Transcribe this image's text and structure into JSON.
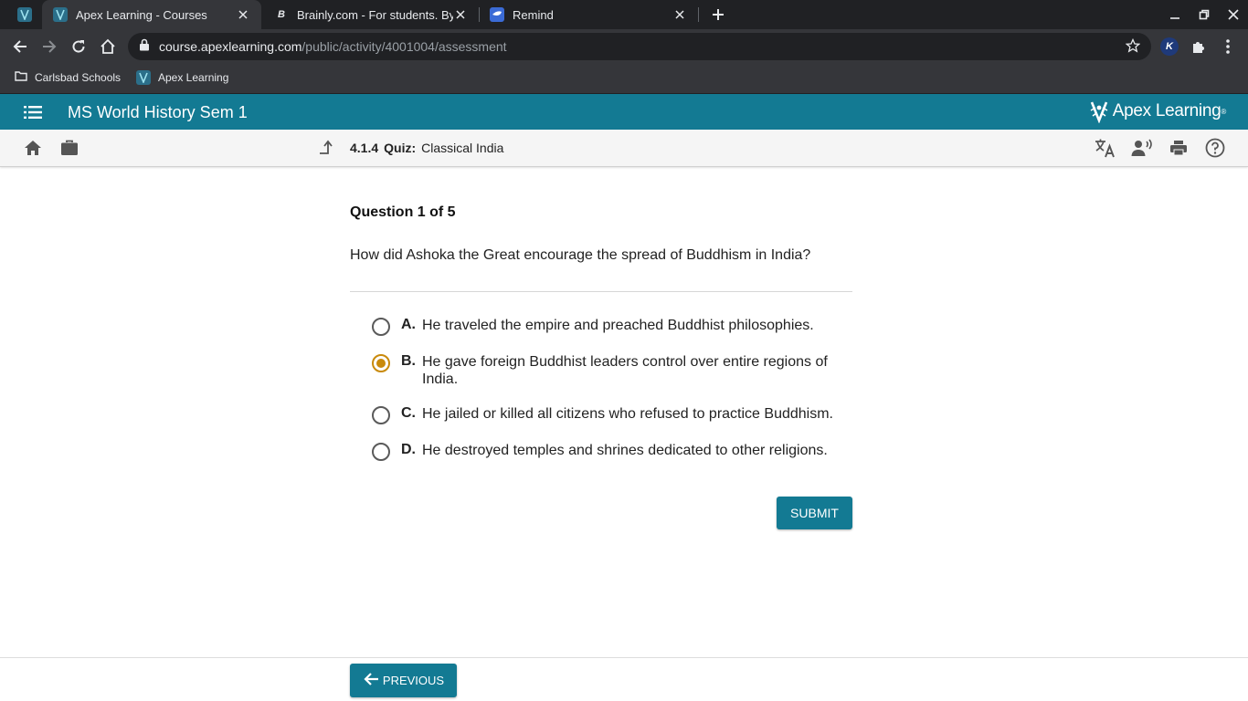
{
  "browser": {
    "tabs": [
      {
        "title": "Apex Learning - Courses",
        "active": true
      },
      {
        "title": "Brainly.com - For students. By students.",
        "active": false
      },
      {
        "title": "Remind",
        "active": false
      }
    ],
    "url_domain": "course.apexlearning.com",
    "url_path": "/public/activity/4001004/assessment",
    "profile_initial": "K",
    "bookmarks": [
      "Carlsbad Schools",
      "Apex Learning"
    ]
  },
  "header": {
    "course_title": "MS World History Sem 1",
    "logo_text": "Apex Learning",
    "logo_mark": "®"
  },
  "breadcrumb": {
    "number": "4.1.4",
    "type": "Quiz:",
    "title": "Classical India"
  },
  "quiz": {
    "counter": "Question 1 of 5",
    "question": "How did Ashoka the Great encourage the spread of Buddhism in India?",
    "choices": [
      {
        "letter": "A.",
        "text": "He traveled the empire and preached Buddhist philosophies.",
        "selected": false
      },
      {
        "letter": "B.",
        "text": "He gave foreign Buddhist leaders control over entire regions of India.",
        "selected": true
      },
      {
        "letter": "C.",
        "text": "He jailed or killed all citizens who refused to practice Buddhism.",
        "selected": false
      },
      {
        "letter": "D.",
        "text": "He destroyed temples and shrines dedicated to other religions.",
        "selected": false
      }
    ],
    "submit_label": "SUBMIT"
  },
  "footer": {
    "previous_label": "PREVIOUS"
  },
  "colors": {
    "brand_teal": "#137a93",
    "selected_radio": "#c98a0c"
  }
}
